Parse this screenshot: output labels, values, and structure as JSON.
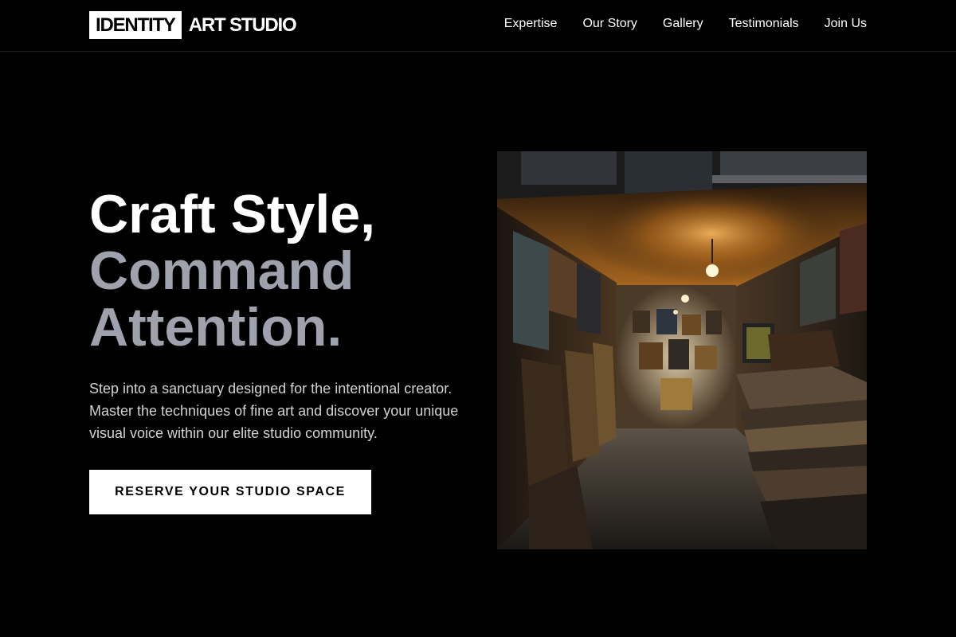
{
  "header": {
    "logo": {
      "box_text": "IDENTITY",
      "text": "ART STUDIO"
    },
    "nav": [
      {
        "label": "Expertise"
      },
      {
        "label": "Our Story"
      },
      {
        "label": "Gallery"
      },
      {
        "label": "Testimonials"
      },
      {
        "label": "Join Us"
      }
    ]
  },
  "hero": {
    "headline": {
      "line1": "Craft Style,",
      "line2": "Command",
      "line3": "Attention."
    },
    "description": "Step into a sanctuary designed for the intentional creator. Master the techniques of fine art and discover your unique visual voice within our elite studio community.",
    "cta_label": "RESERVE YOUR STUDIO SPACE"
  },
  "colors": {
    "background": "#000000",
    "text": "#ffffff",
    "headline_accent": "#9fa2ad",
    "body_text": "#d2d2d2",
    "button_bg": "#ffffff",
    "button_text": "#000000"
  }
}
